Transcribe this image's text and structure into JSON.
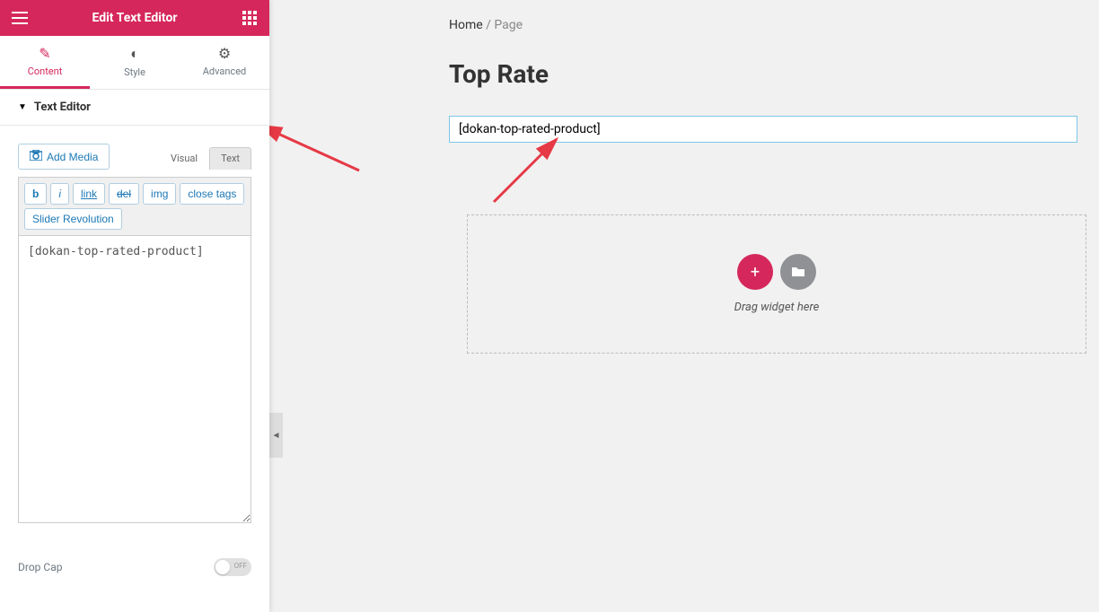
{
  "header": {
    "title": "Edit Text Editor"
  },
  "tabs": {
    "content": "Content",
    "style": "Style",
    "advanced": "Advanced"
  },
  "section": {
    "title": "Text Editor"
  },
  "editor": {
    "add_media": "Add Media",
    "visual_tab": "Visual",
    "text_tab": "Text",
    "toolbar": {
      "bold": "b",
      "italic": "i",
      "link": "link",
      "del": "del",
      "img": "img",
      "close_tags": "close tags",
      "slider": "Slider Revolution"
    },
    "content": "[dokan-top-rated-product]"
  },
  "drop_cap": {
    "label": "Drop Cap",
    "toggle_text": "OFF"
  },
  "preview": {
    "breadcrumb_home": "Home",
    "breadcrumb_sep": " / ",
    "breadcrumb_page": "Page",
    "page_title": "Top Rate",
    "shortcode": "[dokan-top-rated-product]",
    "drop_text": "Drag widget here"
  }
}
